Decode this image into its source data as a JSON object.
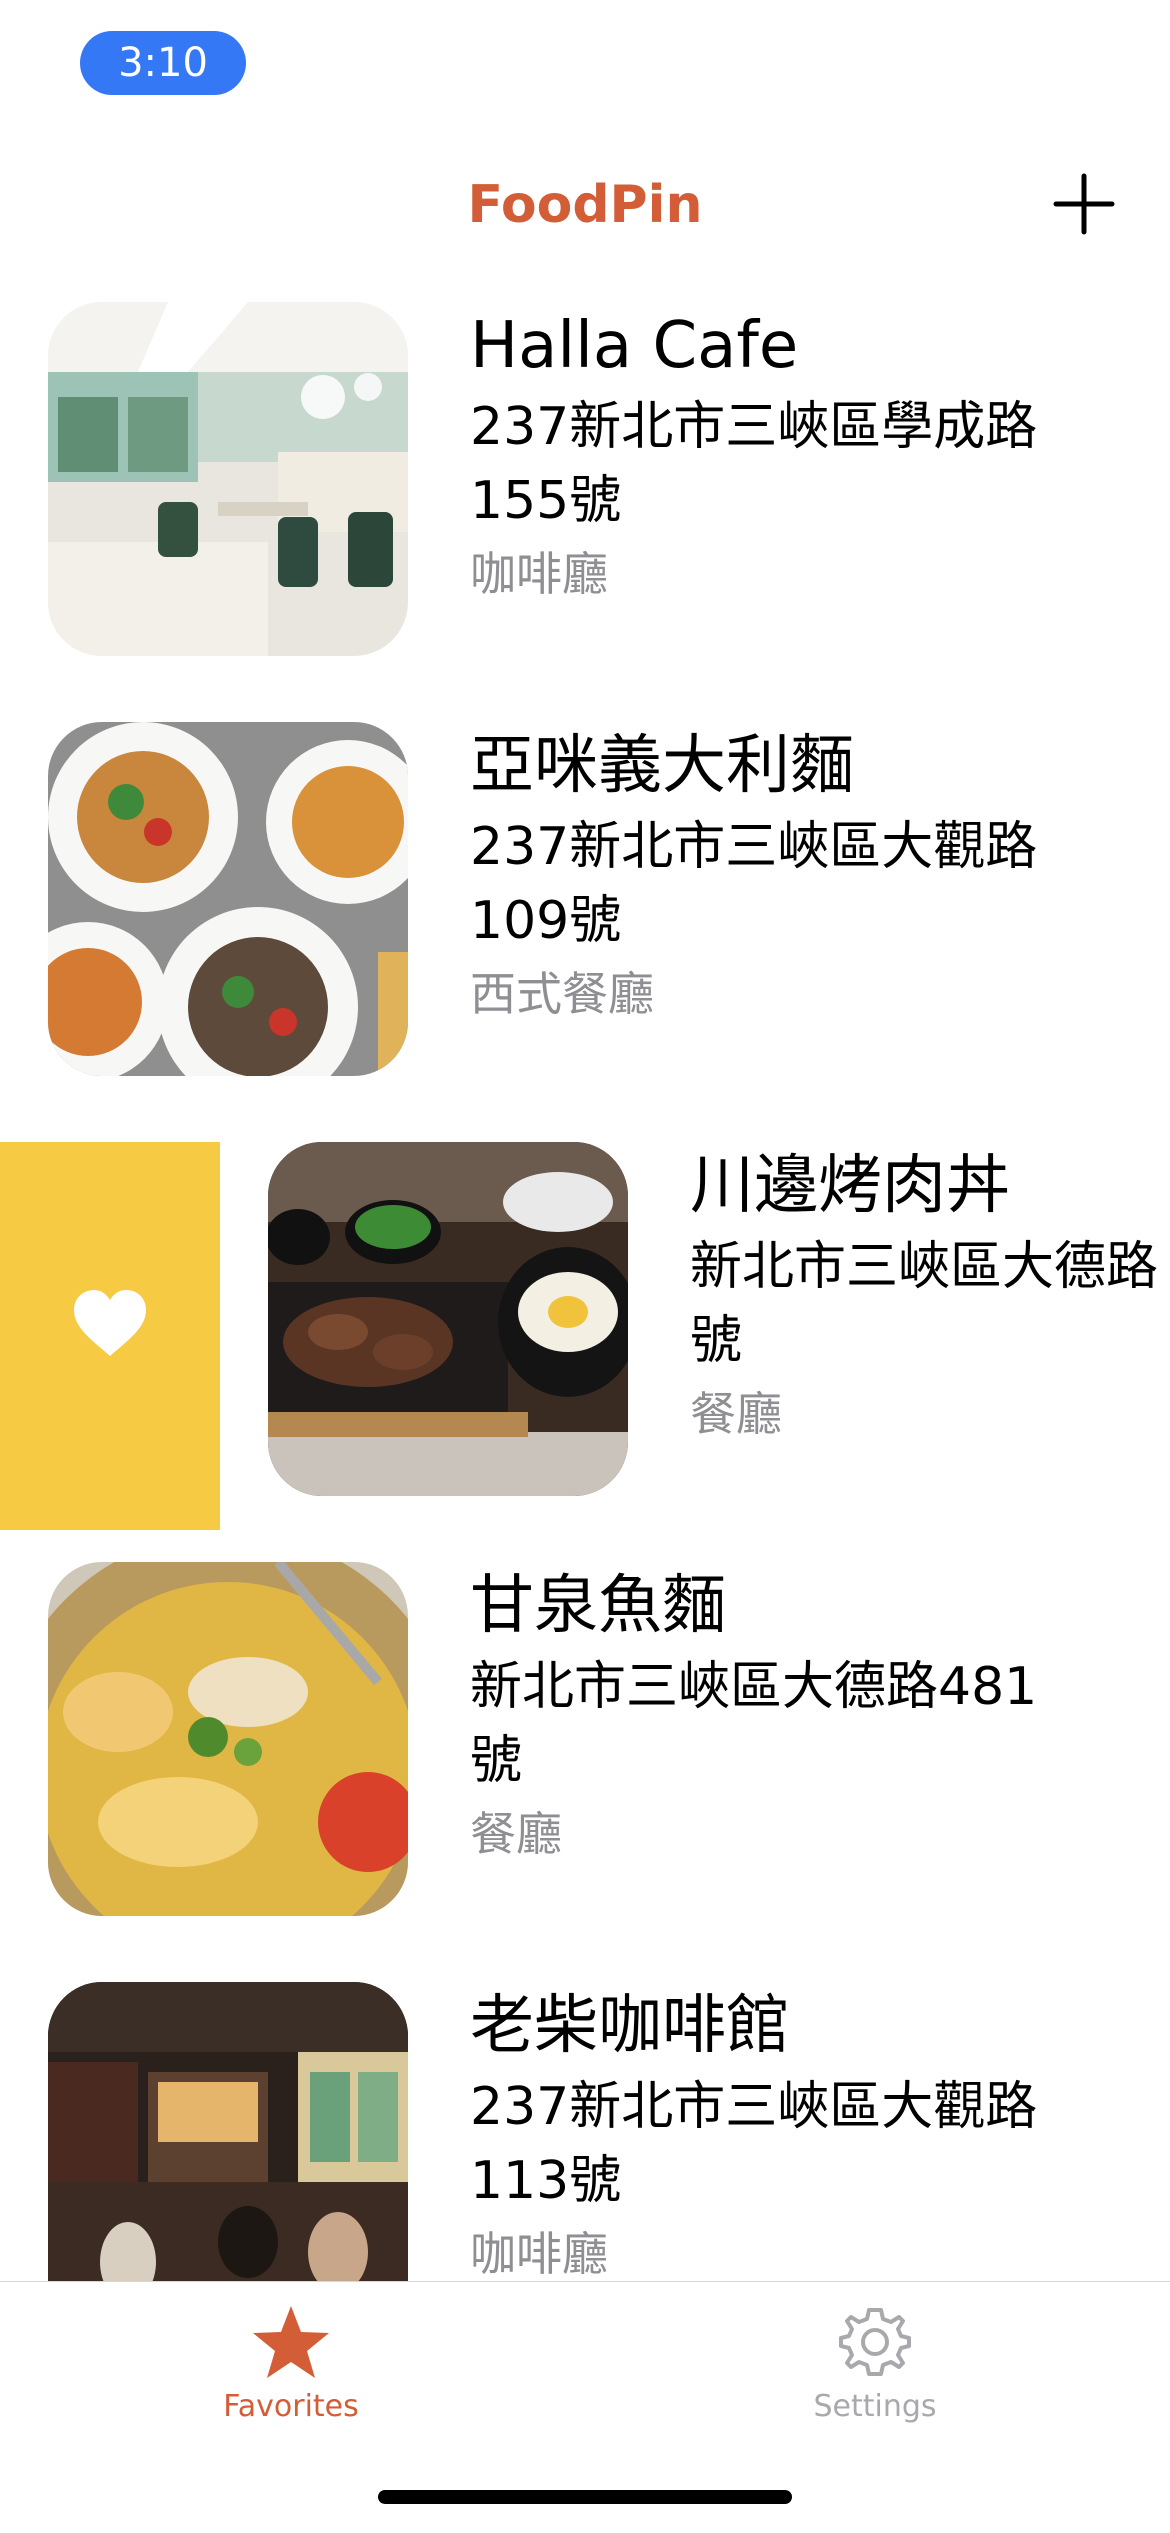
{
  "status_bar": {
    "time": "3:10"
  },
  "nav": {
    "title": "FoodPin",
    "add_icon": "plus-icon"
  },
  "colors": {
    "accent": "#d35d36",
    "favorite_action": "#f6ca43",
    "secondary_text": "#8e8e93",
    "tab_inactive": "#a8a8ad"
  },
  "restaurants": [
    {
      "name": "Halla Cafe",
      "address_line1": "237新北市三峽區學成路",
      "address_line2": "155號",
      "category": "咖啡廳",
      "thumbnail": "cafe-interior"
    },
    {
      "name": "亞咪義大利麵",
      "address_line1": "237新北市三峽區大觀路",
      "address_line2": "109號",
      "category": "西式餐廳",
      "thumbnail": "pasta-plates"
    },
    {
      "name": "川邊烤肉丼",
      "address_line1": "新北市三峽區大德路",
      "address_line2": "號",
      "category": "餐廳",
      "thumbnail": "grilled-meat-set",
      "swipe_action": "heart-icon"
    },
    {
      "name": "甘泉魚麵",
      "address_line1": "新北市三峽區大德路481",
      "address_line2": "號",
      "category": "餐廳",
      "thumbnail": "fish-noodle-soup"
    },
    {
      "name": "老柴咖啡館",
      "address_line1": "237新北市三峽區大觀路",
      "address_line2": "113號",
      "category": "咖啡廳",
      "thumbnail": "coffee-shop-interior"
    }
  ],
  "tabs": [
    {
      "label": "Favorites",
      "icon": "star-icon",
      "selected": true
    },
    {
      "label": "Settings",
      "icon": "gear-icon",
      "selected": false
    }
  ]
}
